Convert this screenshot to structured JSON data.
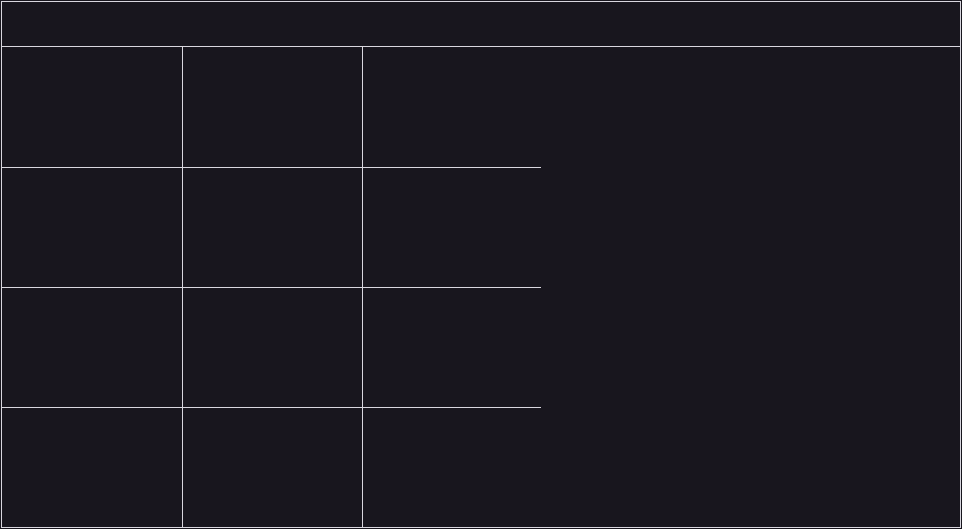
{
  "header": {
    "title": ""
  },
  "grid": {
    "rows": 4,
    "columns": 3,
    "tiles": [
      {
        "label": ""
      },
      {
        "label": ""
      },
      {
        "label": ""
      },
      {
        "label": ""
      },
      {
        "label": ""
      },
      {
        "label": ""
      },
      {
        "label": ""
      },
      {
        "label": ""
      },
      {
        "label": ""
      },
      {
        "label": ""
      },
      {
        "label": ""
      },
      {
        "label": ""
      }
    ]
  },
  "side_panel": {
    "title": ""
  },
  "colors": {
    "background": "#18161e",
    "border": "#d9d7df"
  }
}
